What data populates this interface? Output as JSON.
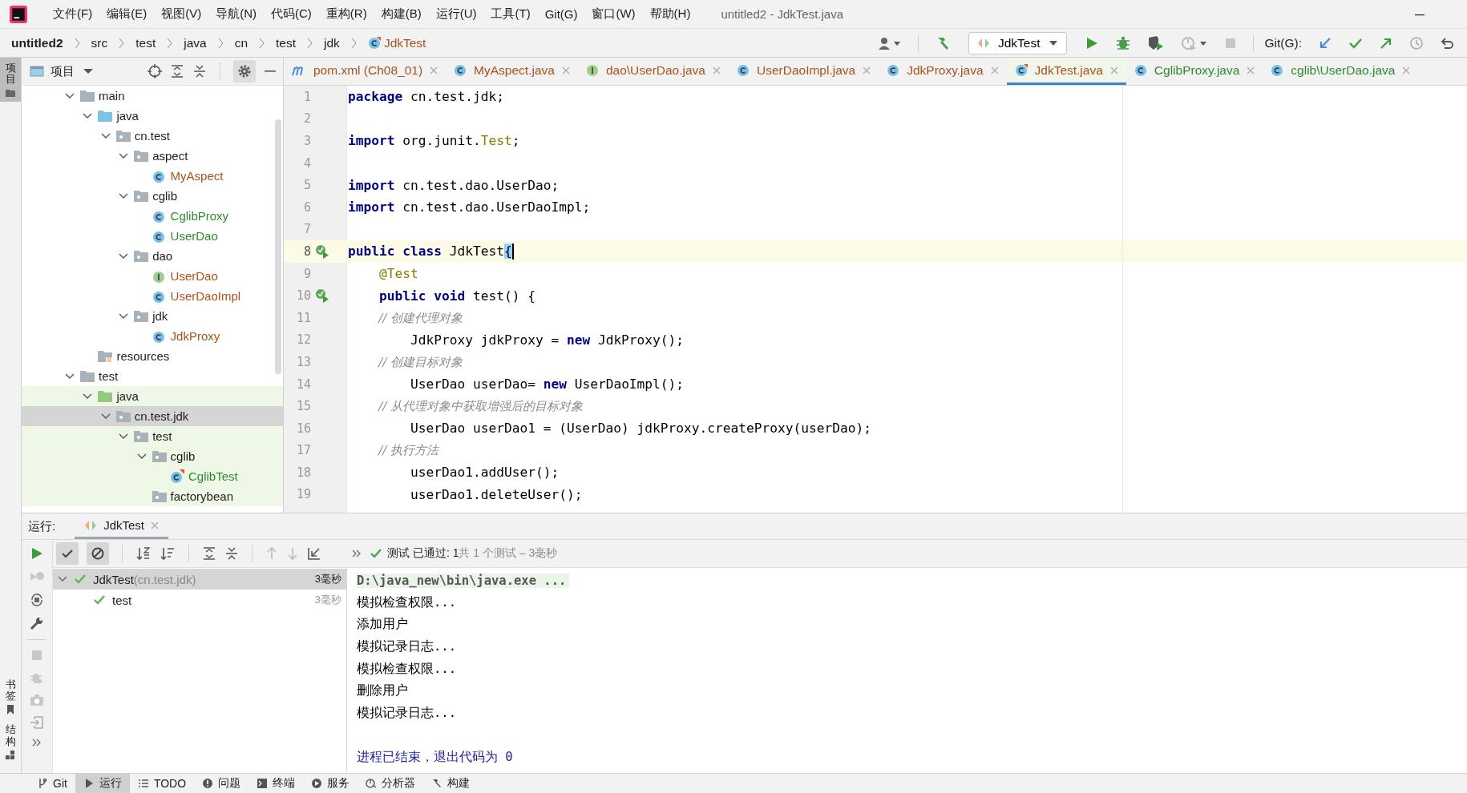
{
  "window": {
    "title": "untitled2 - JdkTest.java"
  },
  "menu": [
    "文件(F)",
    "编辑(E)",
    "视图(V)",
    "导航(N)",
    "代码(C)",
    "重构(R)",
    "构建(B)",
    "运行(U)",
    "工具(T)",
    "Git(G)",
    "窗口(W)",
    "帮助(H)"
  ],
  "breadcrumbs": [
    {
      "label": "untitled2",
      "kind": "project"
    },
    {
      "label": "src",
      "kind": "dir"
    },
    {
      "label": "test",
      "kind": "dir"
    },
    {
      "label": "java",
      "kind": "dir"
    },
    {
      "label": "cn",
      "kind": "dir"
    },
    {
      "label": "test",
      "kind": "dir"
    },
    {
      "label": "jdk",
      "kind": "dir"
    },
    {
      "label": "JdkTest",
      "kind": "test-class"
    }
  ],
  "toolbar": {
    "run_config": "JdkTest",
    "git_label": "Git(G):"
  },
  "side_tabs": {
    "top": [
      {
        "label": "项目",
        "selected": true
      }
    ],
    "bottom": [
      {
        "label": "书签",
        "selected": false
      },
      {
        "label": "结构",
        "selected": false
      }
    ]
  },
  "project_panel": {
    "title": "项目",
    "tree": [
      {
        "name": "main",
        "kind": "folder",
        "expanded": true,
        "selected": false,
        "children": [
          {
            "name": "java",
            "kind": "source-root",
            "expanded": true,
            "selected": false,
            "children": [
              {
                "name": "cn.test",
                "kind": "package",
                "expanded": true,
                "selected": false,
                "children": [
                  {
                    "name": "aspect",
                    "kind": "package",
                    "expanded": true,
                    "selected": false,
                    "children": [
                      {
                        "name": "MyAspect",
                        "kind": "class",
                        "color": "#a8521c",
                        "selected": false
                      }
                    ]
                  },
                  {
                    "name": "cglib",
                    "kind": "package",
                    "expanded": true,
                    "selected": false,
                    "children": [
                      {
                        "name": "CglibProxy",
                        "kind": "class",
                        "color": "#2f8a2f",
                        "selected": false
                      },
                      {
                        "name": "UserDao",
                        "kind": "class",
                        "color": "#2f8a2f",
                        "selected": false
                      }
                    ]
                  },
                  {
                    "name": "dao",
                    "kind": "package",
                    "expanded": true,
                    "selected": false,
                    "children": [
                      {
                        "name": "UserDao",
                        "kind": "interface",
                        "color": "#a8521c",
                        "selected": false
                      },
                      {
                        "name": "UserDaoImpl",
                        "kind": "class",
                        "color": "#a8521c",
                        "selected": false
                      }
                    ]
                  },
                  {
                    "name": "jdk",
                    "kind": "package",
                    "expanded": true,
                    "selected": false,
                    "children": [
                      {
                        "name": "JdkProxy",
                        "kind": "class",
                        "color": "#a8521c",
                        "selected": false
                      }
                    ]
                  }
                ]
              }
            ]
          },
          {
            "name": "resources",
            "kind": "resources-root",
            "selected": false
          }
        ]
      },
      {
        "name": "test",
        "kind": "folder",
        "expanded": true,
        "selected": false,
        "children": [
          {
            "name": "java",
            "kind": "test-root",
            "expanded": true,
            "selected": false,
            "children": [
              {
                "name": "cn.test.jdk",
                "kind": "package",
                "expanded": true,
                "selected": true,
                "children": [
                  {
                    "name": "test",
                    "kind": "package",
                    "expanded": true,
                    "selected": false,
                    "children": [
                      {
                        "name": "cglib",
                        "kind": "package",
                        "expanded": true,
                        "selected": false,
                        "children": [
                          {
                            "name": "CglibTest",
                            "kind": "test-class",
                            "color": "#2f8a2f",
                            "selected": false
                          }
                        ]
                      },
                      {
                        "name": "factorybean",
                        "kind": "package",
                        "selected": false
                      }
                    ]
                  }
                ]
              }
            ]
          }
        ]
      }
    ]
  },
  "editor": {
    "tabs": [
      {
        "label": "pom.xml (Ch08_01)",
        "kind": "maven",
        "color": "#a8521c",
        "selected": false
      },
      {
        "label": "MyAspect.java",
        "kind": "class",
        "color": "#a8521c",
        "selected": false
      },
      {
        "label": "dao\\UserDao.java",
        "kind": "interface",
        "color": "#a8521c",
        "selected": false
      },
      {
        "label": "UserDaoImpl.java",
        "kind": "class",
        "color": "#a8521c",
        "selected": false
      },
      {
        "label": "JdkProxy.java",
        "kind": "class",
        "color": "#a8521c",
        "selected": false
      },
      {
        "label": "JdkTest.java",
        "kind": "test-class",
        "color": "#a8521c",
        "selected": true
      },
      {
        "label": "CglibProxy.java",
        "kind": "class",
        "color": "#2f8a2f",
        "selected": false
      },
      {
        "label": "cglib\\UserDao.java",
        "kind": "class",
        "color": "#2f8a2f",
        "selected": false
      }
    ],
    "lines": [
      {
        "number": "1",
        "current": false,
        "runnable": false,
        "tokens": [
          {
            "kind": "kw",
            "text": "package"
          },
          {
            "kind": "plain",
            "text": " cn.test.jdk;"
          }
        ]
      },
      {
        "number": "2",
        "current": false,
        "runnable": false
      },
      {
        "number": "3",
        "current": false,
        "runnable": false,
        "tokens": [
          {
            "kind": "kw",
            "text": "import"
          },
          {
            "kind": "plain",
            "text": " org.junit."
          },
          {
            "kind": "ref",
            "text": "Test"
          },
          {
            "kind": "plain",
            "text": ";"
          }
        ]
      },
      {
        "number": "4",
        "current": false,
        "runnable": false
      },
      {
        "number": "5",
        "current": false,
        "runnable": false,
        "tokens": [
          {
            "kind": "kw",
            "text": "import"
          },
          {
            "kind": "plain",
            "text": " cn.test.dao.UserDao;"
          }
        ]
      },
      {
        "number": "6",
        "current": false,
        "runnable": false,
        "tokens": [
          {
            "kind": "kw",
            "text": "import"
          },
          {
            "kind": "plain",
            "text": " cn.test.dao.UserDaoImpl;"
          }
        ]
      },
      {
        "number": "7",
        "current": false,
        "runnable": false
      },
      {
        "number": "8",
        "current": true,
        "runnable": true,
        "tokens": [
          {
            "kind": "kw",
            "text": "public class"
          },
          {
            "kind": "plain",
            "text": " JdkTest"
          },
          {
            "kind": "match",
            "text": "{"
          }
        ]
      },
      {
        "number": "9",
        "current": false,
        "runnable": false,
        "tokens": [
          {
            "kind": "ann",
            "text": "    @Test"
          }
        ]
      },
      {
        "number": "10",
        "current": false,
        "runnable": true,
        "tokens": [
          {
            "kind": "kw",
            "text": "    public void"
          },
          {
            "kind": "plain",
            "text": " test() {"
          }
        ]
      },
      {
        "number": "11",
        "current": false,
        "runnable": false,
        "tokens": [
          {
            "kind": "cm",
            "text": "        // 创建代理对象"
          }
        ]
      },
      {
        "number": "12",
        "current": false,
        "runnable": false,
        "tokens": [
          {
            "kind": "plain",
            "text": "        JdkProxy jdkProxy = "
          },
          {
            "kind": "kw",
            "text": "new"
          },
          {
            "kind": "plain",
            "text": " JdkProxy();"
          }
        ]
      },
      {
        "number": "13",
        "current": false,
        "runnable": false,
        "tokens": [
          {
            "kind": "cm",
            "text": "        // 创建目标对象"
          }
        ]
      },
      {
        "number": "14",
        "current": false,
        "runnable": false,
        "tokens": [
          {
            "kind": "plain",
            "text": "        UserDao userDao= "
          },
          {
            "kind": "kw",
            "text": "new"
          },
          {
            "kind": "plain",
            "text": " UserDaoImpl();"
          }
        ]
      },
      {
        "number": "15",
        "current": false,
        "runnable": false,
        "tokens": [
          {
            "kind": "cm",
            "text": "        // 从代理对象中获取增强后的目标对象"
          }
        ]
      },
      {
        "number": "16",
        "current": false,
        "runnable": false,
        "tokens": [
          {
            "kind": "plain",
            "text": "        UserDao userDao1 = (UserDao) jdkProxy.createProxy(userDao);"
          }
        ]
      },
      {
        "number": "17",
        "current": false,
        "runnable": false,
        "tokens": [
          {
            "kind": "cm",
            "text": "        // 执行方法"
          }
        ]
      },
      {
        "number": "18",
        "current": false,
        "runnable": false,
        "tokens": [
          {
            "kind": "plain",
            "text": "        userDao1.addUser();"
          }
        ]
      },
      {
        "number": "19",
        "current": false,
        "runnable": false,
        "tokens": [
          {
            "kind": "plain",
            "text": "        userDao1.deleteUser();"
          }
        ]
      }
    ]
  },
  "run_panel": {
    "label": "运行:",
    "tab": "JdkTest",
    "filters": [
      {
        "kind": "passed",
        "selected": true
      },
      {
        "kind": "ignored",
        "selected": true
      }
    ],
    "status_passed": "测试 已通过: 1",
    "status_summary": "共 1 个测试 – 3毫秒",
    "tests": [
      {
        "name": "JdkTest",
        "detail": "(cn.test.jdk)",
        "time": "3毫秒",
        "passed": true,
        "expanded": true,
        "selected": true,
        "children": [
          {
            "name": "test",
            "time": "3毫秒",
            "passed": true,
            "selected": false
          }
        ]
      }
    ],
    "console": [
      {
        "kind": "command",
        "text": "D:\\java_new\\bin\\java.exe ..."
      },
      {
        "kind": "output",
        "text": "模拟检查权限..."
      },
      {
        "kind": "output",
        "text": "添加用户"
      },
      {
        "kind": "output",
        "text": "模拟记录日志..."
      },
      {
        "kind": "output",
        "text": "模拟检查权限..."
      },
      {
        "kind": "output",
        "text": "删除用户"
      },
      {
        "kind": "output",
        "text": "模拟记录日志..."
      },
      {
        "kind": "blank"
      },
      {
        "kind": "exit",
        "text": "进程已结束，退出代码为 0"
      }
    ]
  },
  "status_bar": [
    {
      "label": "Git",
      "kind": "git",
      "selected": false
    },
    {
      "label": "运行",
      "kind": "run",
      "selected": true
    },
    {
      "label": "TODO",
      "kind": "todo",
      "selected": false
    },
    {
      "label": "问题",
      "kind": "problems",
      "selected": false
    },
    {
      "label": "终端",
      "kind": "terminal",
      "selected": false
    },
    {
      "label": "服务",
      "kind": "services",
      "selected": false
    },
    {
      "label": "分析器",
      "kind": "profiler",
      "selected": false
    },
    {
      "label": "构建",
      "kind": "build",
      "selected": false
    }
  ]
}
